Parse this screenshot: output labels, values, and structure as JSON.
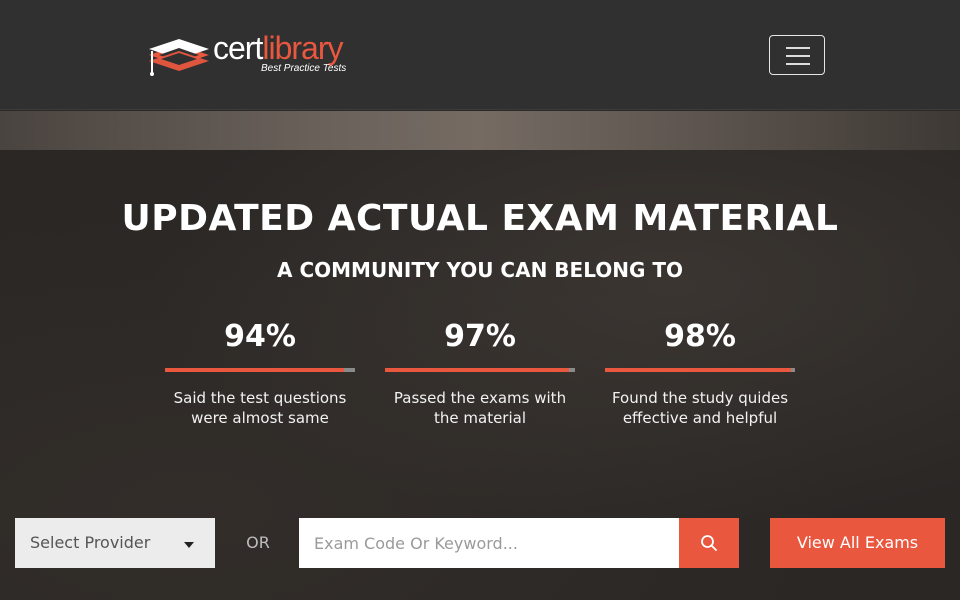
{
  "brand": {
    "name_part1": "cert",
    "name_part2": "library",
    "tagline": "Best Practice Tests",
    "accent_color": "#e9573f"
  },
  "nav": {
    "menu_icon": "hamburger-menu-icon"
  },
  "hero": {
    "headline": "UPDATED ACTUAL EXAM MATERIAL",
    "subheadline": "A COMMUNITY YOU CAN BELONG TO",
    "stats": [
      {
        "value": "94%",
        "fraction": 0.94,
        "text": "Said the test questions were almost same"
      },
      {
        "value": "97%",
        "fraction": 0.97,
        "text": "Passed the exams with the material"
      },
      {
        "value": "98%",
        "fraction": 0.98,
        "text": "Found the study quides effective and helpful"
      }
    ]
  },
  "search": {
    "provider_select": "Select Provider",
    "or_label": "OR",
    "keyword_placeholder": "Exam Code Or Keyword...",
    "keyword_value": "",
    "search_icon": "search-icon",
    "view_all_label": "View All Exams"
  }
}
